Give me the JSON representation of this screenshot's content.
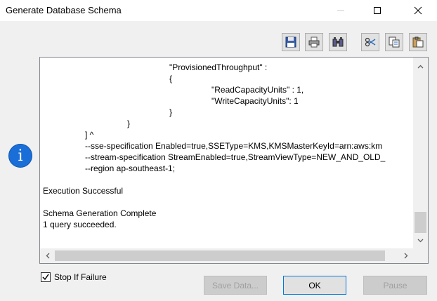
{
  "window": {
    "title": "Generate Database Schema"
  },
  "output_lines": [
    {
      "text": "\"ProvisionedThroughput\" :",
      "indent": 4
    },
    {
      "text": "{",
      "indent": 4
    },
    {
      "text": "\"ReadCapacityUnits\" : 1,",
      "indent": 5
    },
    {
      "text": "\"WriteCapacityUnits\": 1",
      "indent": 5
    },
    {
      "text": "}",
      "indent": 4
    },
    {
      "text": "}",
      "indent": 3
    },
    {
      "text": "] ^",
      "indent": 2
    },
    {
      "text": "--sse-specification Enabled=true,SSEType=KMS,KMSMasterKeyId=arn:aws:km",
      "indent": 2
    },
    {
      "text": "--stream-specification StreamEnabled=true,StreamViewType=NEW_AND_OLD_",
      "indent": 2
    },
    {
      "text": "--region ap-southeast-1;",
      "indent": 2
    },
    {
      "text": "",
      "indent": 0
    },
    {
      "text": "Execution Successful",
      "indent": 0
    },
    {
      "text": "",
      "indent": 0
    },
    {
      "text": "Schema Generation Complete",
      "indent": 0
    },
    {
      "text": "1 query succeeded.",
      "indent": 0
    }
  ],
  "stop_if_failure": {
    "label": "Stop If Failure",
    "checked": true
  },
  "buttons": {
    "save_data": "Save Data...",
    "ok": "OK",
    "pause": "Pause"
  },
  "icons": {
    "info": "i"
  }
}
